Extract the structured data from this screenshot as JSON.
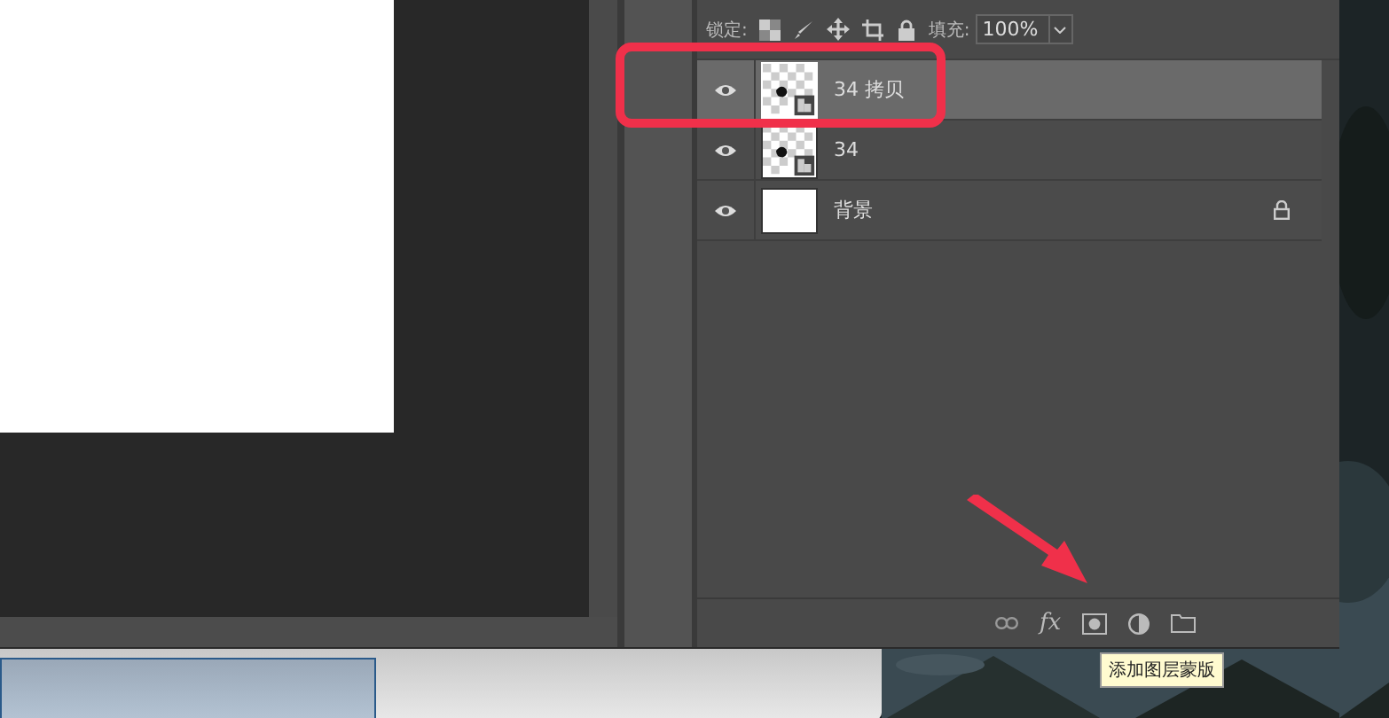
{
  "lock_bar": {
    "lock_label": "锁定:",
    "fill_label": "填充:",
    "fill_value": "100%"
  },
  "layers": [
    {
      "name": "34 拷贝",
      "visible": true,
      "selected": true,
      "kind": "smart_object",
      "locked": false
    },
    {
      "name": "34",
      "visible": true,
      "selected": false,
      "kind": "smart_object",
      "locked": false
    },
    {
      "name": "背景",
      "visible": true,
      "selected": false,
      "locked": true
    }
  ],
  "footer": {
    "fx_label": "fx"
  },
  "tooltip": "添加图层蒙版"
}
